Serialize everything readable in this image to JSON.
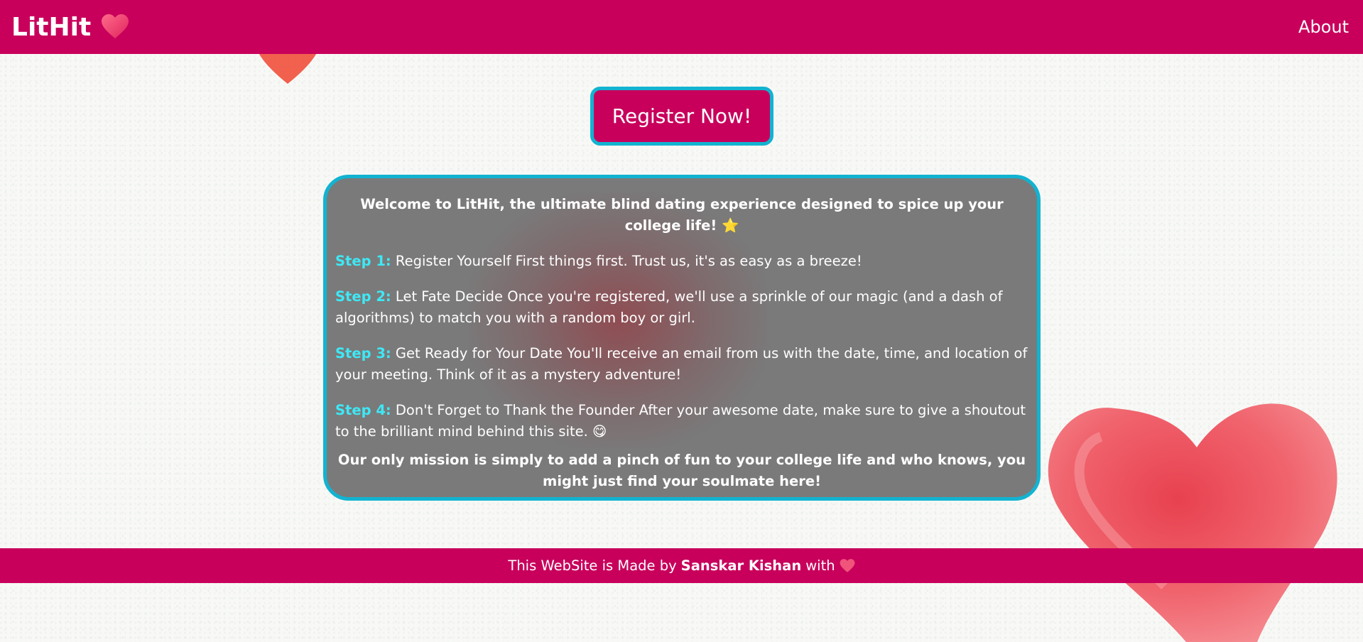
{
  "navbar": {
    "brand": "LitHit",
    "brand_icon": "heart-icon",
    "about_label": "About"
  },
  "register_label": "Register Now!",
  "card": {
    "welcome": "Welcome to LitHit, the ultimate blind dating experience designed to spice up your college life! ⭐",
    "steps": [
      {
        "label": "Step 1:",
        "text": "Register Yourself First things first. Trust us, it's as easy as a breeze!"
      },
      {
        "label": "Step 2:",
        "text": "Let Fate Decide Once you're registered, we'll use a sprinkle of our magic (and a dash of algorithms) to match you with a random boy or girl."
      },
      {
        "label": "Step 3:",
        "text": "Get Ready for Your Date You'll receive an email from us with the date, time, and location of your meeting. Think of it as a mystery adventure!"
      },
      {
        "label": "Step 4:",
        "text": "Don't Forget to Thank the Founder After your awesome date, make sure to give a shoutout to the brilliant mind behind this site. 😋"
      }
    ],
    "mission": "Our only mission is simply to add a pinch of fun to your college life and who knows, you might just find your soulmate here!"
  },
  "footer": {
    "prefix": "This WebSite is Made by",
    "author": "Sanskar Kishan",
    "suffix": "with",
    "icon": "heart-icon"
  },
  "colors": {
    "brand": "#c8005c",
    "accent_border": "#12b3d1",
    "step_label": "#3ee8f5",
    "card_bg": "#767676"
  }
}
